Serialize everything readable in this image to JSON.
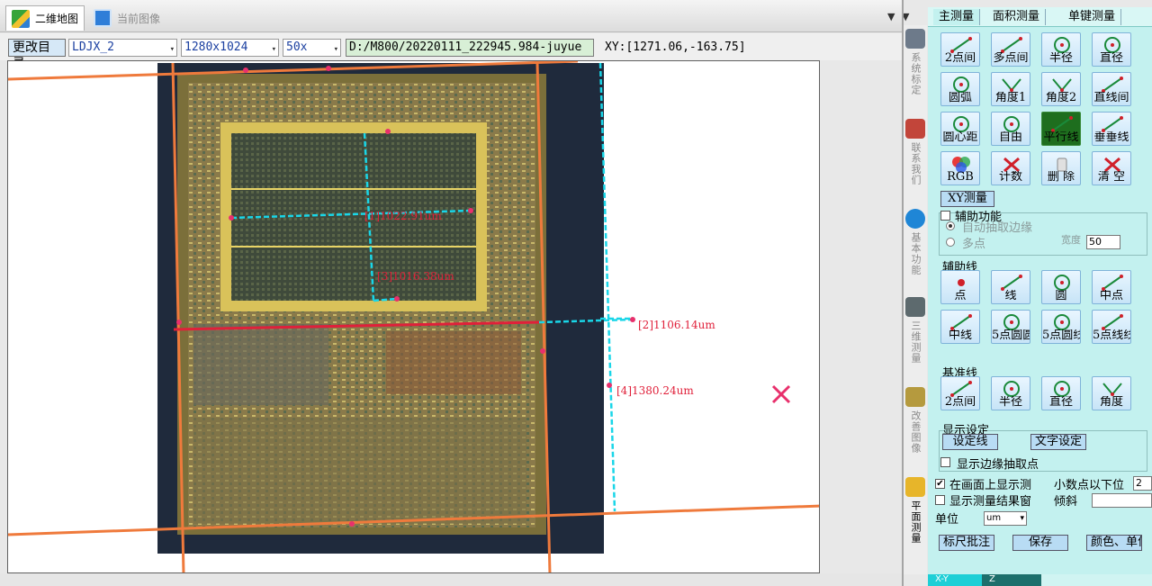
{
  "tabs": [
    {
      "label": "二维地图",
      "active": true
    },
    {
      "label": "当前图像",
      "active": false
    }
  ],
  "window_menu": "▼ ▼",
  "toolbar": {
    "change_dir_label": "更改目录",
    "project": "LDJX_2",
    "resolution": "1280x1024",
    "magnification": "50x",
    "path": "D:/M800/20220111_222945.984-juyue",
    "xy_readout": "XY:[1271.06,-163.75]"
  },
  "measurements": [
    {
      "id": "1",
      "label": "[1]1022.91um"
    },
    {
      "id": "2",
      "label": "[2]1106.14um"
    },
    {
      "id": "3",
      "label": "[3]1016.38um"
    },
    {
      "id": "4",
      "label": "[4]1380.24um"
    }
  ],
  "side_nav": [
    {
      "label": "系统标定",
      "icon": "microscope-icon"
    },
    {
      "label": "联系我们",
      "icon": "contact-icon"
    },
    {
      "label": "基本功能",
      "icon": "tools-icon"
    },
    {
      "label": "三维测量",
      "icon": "3d-measure-icon"
    },
    {
      "label": "改善图像",
      "icon": "enhance-image-icon"
    },
    {
      "label": "平面测量",
      "icon": "ruler-icon",
      "active": true
    }
  ],
  "panel": {
    "tabs": [
      "主测量",
      "面积测量",
      "单键测量"
    ],
    "main_tools": [
      "2点间",
      "多点间",
      "半径",
      "直径",
      "圆弧",
      "角度1",
      "角度2",
      "直线间",
      "圆心距",
      "自由",
      "平行线",
      "垂垂线",
      "RGB",
      "计数",
      "删 除",
      "清 空"
    ],
    "xy_measure_label": "XY测量",
    "assist": {
      "title": "辅助功能",
      "auto_edge": "自动抽取边缘",
      "multi_point": "多点",
      "width_label": "宽度",
      "width_value": "50"
    },
    "aux_line": {
      "title": "辅助线",
      "buttons": [
        "点",
        "线",
        "圆",
        "中点",
        "中线",
        "5点圆圆",
        "5点圆线",
        "5点线线"
      ]
    },
    "baseline": {
      "title": "基准线",
      "buttons": [
        "2点间",
        "半径",
        "直径",
        "角度"
      ]
    },
    "display": {
      "title": "显示设定",
      "set_line": "设定线",
      "text_setting": "文字设定",
      "show_edge_points": "显示边缘抽取点"
    },
    "show_on_screen": "在画面上显示测",
    "decimals_label": "小数点以下位",
    "decimals_value": "2",
    "show_result_window": "显示测量结果窗",
    "tilt_label": "倾斜",
    "unit_label": "单位",
    "unit_value": "um",
    "scale_note_btn": "标尺批注",
    "save_btn": "保存",
    "color_unit_btn": "颜色、单位"
  },
  "status_tabs": [
    "X-Y",
    "Z"
  ],
  "colors": {
    "panel_bg": "#c3f1ef",
    "measure_cyan": "#19d6e8",
    "measure_red": "#e0203a",
    "guide_orange": "#ef7a3c",
    "cross_magenta": "#e8306c"
  }
}
